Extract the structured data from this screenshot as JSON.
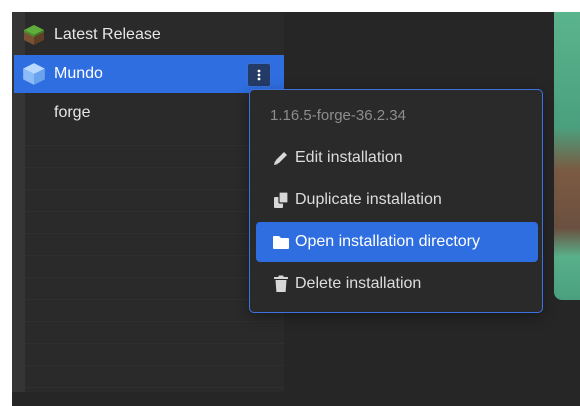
{
  "sidebar": {
    "items": [
      {
        "label": "Latest Release",
        "icon": "grass-block-icon"
      },
      {
        "label": "Mundo",
        "icon": "cube-icon",
        "selected": true
      },
      {
        "label": "forge"
      }
    ]
  },
  "context_menu": {
    "version": "1.16.5-forge-36.2.34",
    "items": [
      {
        "label": "Edit installation",
        "icon": "pencil-icon"
      },
      {
        "label": "Duplicate installation",
        "icon": "copy-icon"
      },
      {
        "label": "Open installation directory",
        "icon": "folder-icon",
        "highlighted": true
      },
      {
        "label": "Delete installation",
        "icon": "trash-icon"
      }
    ]
  },
  "colors": {
    "accent": "#2e6ee0",
    "sidebar_bg": "#2a2a2a",
    "menu_border": "#3b74e0"
  }
}
